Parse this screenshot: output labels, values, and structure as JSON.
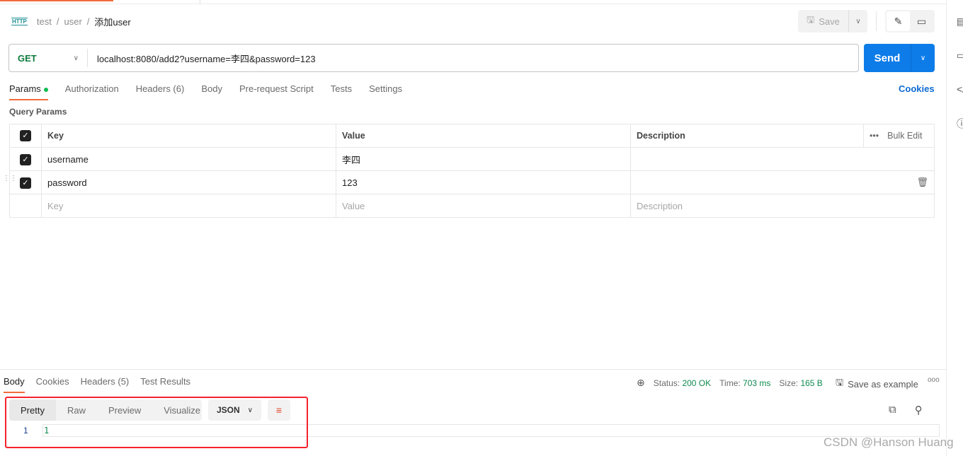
{
  "breadcrumb": {
    "icon": "HTTP",
    "items": [
      "test",
      "user"
    ],
    "current": "添加user"
  },
  "toolbar": {
    "save_label": "Save"
  },
  "request": {
    "method": "GET",
    "url": "localhost:8080/add2?username=李四&password=123",
    "send_label": "Send"
  },
  "req_tabs": [
    "Params",
    "Authorization",
    "Headers (6)",
    "Body",
    "Pre-request Script",
    "Tests",
    "Settings"
  ],
  "cookies_link": "Cookies",
  "query_params": {
    "title": "Query Params",
    "headers": [
      "Key",
      "Value",
      "Description"
    ],
    "bulk_edit": "Bulk Edit",
    "rows": [
      {
        "key": "username",
        "value": "李四",
        "checked": true
      },
      {
        "key": "password",
        "value": "123",
        "checked": true
      }
    ],
    "placeholders": {
      "key": "Key",
      "value": "Value",
      "description": "Description"
    }
  },
  "response": {
    "tabs": [
      "Body",
      "Cookies",
      "Headers (5)",
      "Test Results"
    ],
    "status_label": "Status:",
    "status": "200 OK",
    "time_label": "Time:",
    "time": "703 ms",
    "size_label": "Size:",
    "size": "165 B",
    "save_example": "Save as example",
    "formats": [
      "Pretty",
      "Raw",
      "Preview",
      "Visualize"
    ],
    "language": "JSON",
    "lines": [
      {
        "n": "1",
        "text": "1"
      }
    ]
  },
  "watermark": "CSDN @Hanson Huang",
  "colors": {
    "accent": "#f26b3a",
    "send": "#0d7ce9",
    "method": "#0f7b3d",
    "highlight": "#f5222d"
  }
}
